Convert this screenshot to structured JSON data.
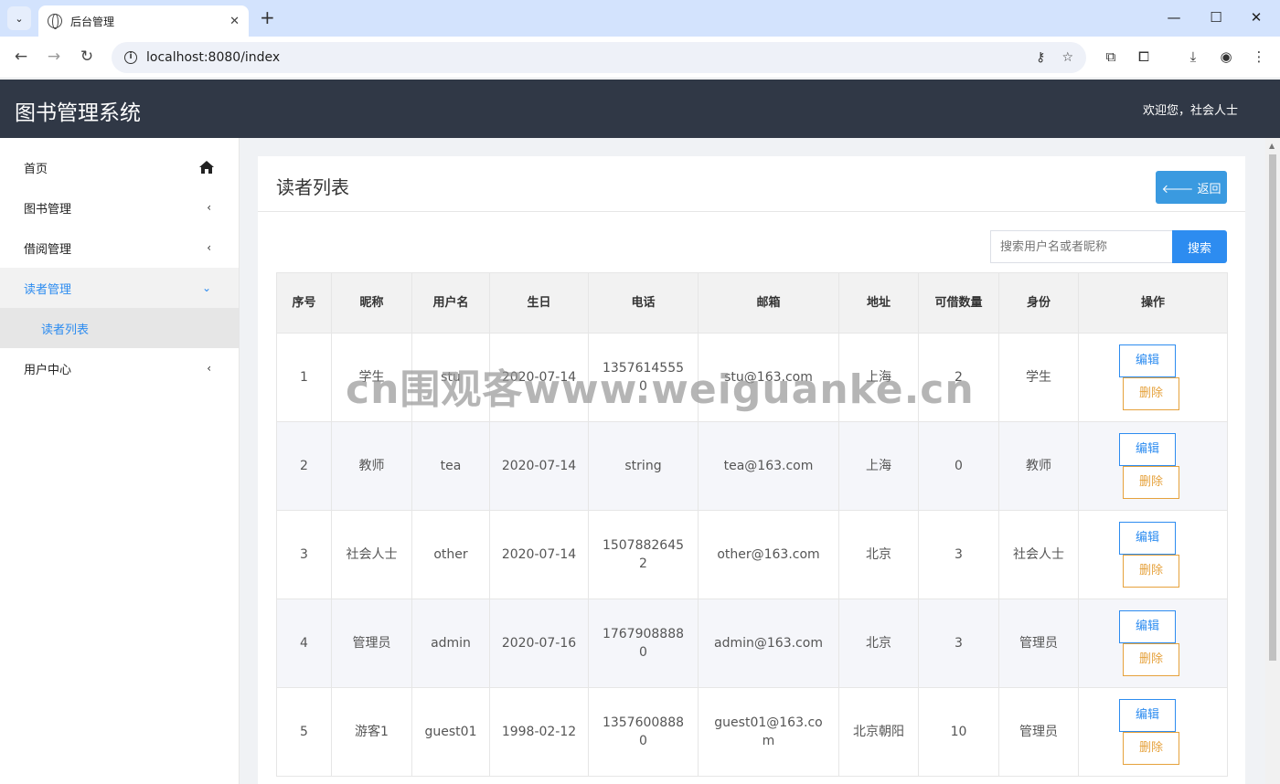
{
  "browser": {
    "tab_title": "后台管理",
    "url": "localhost:8080/index",
    "new_tab": "+",
    "tab_close": "✕"
  },
  "app": {
    "brand": "图书管理系统",
    "welcome": "欢迎您，社会人士"
  },
  "sidebar": {
    "items": [
      {
        "label": "首页"
      },
      {
        "label": "图书管理"
      },
      {
        "label": "借阅管理"
      },
      {
        "label": "读者管理"
      },
      {
        "label": "读者列表"
      },
      {
        "label": "用户中心"
      }
    ]
  },
  "page": {
    "title": "读者列表",
    "back_label": "🡐 返回",
    "search_placeholder": "搜索用户名或者昵称",
    "search_label": "搜索"
  },
  "table": {
    "headers": [
      "序号",
      "昵称",
      "用户名",
      "生日",
      "电话",
      "邮箱",
      "地址",
      "可借数量",
      "身份",
      "操作"
    ],
    "edit_label": "编辑",
    "delete_label": "删除",
    "rows": [
      [
        "1",
        "学生",
        "stu",
        "2020-07-14",
        "13576145550",
        "stu@163.com",
        "上海",
        "2",
        "学生"
      ],
      [
        "2",
        "教师",
        "tea",
        "2020-07-14",
        "string",
        "tea@163.com",
        "上海",
        "0",
        "教师"
      ],
      [
        "3",
        "社会人士",
        "other",
        "2020-07-14",
        "15078826452",
        "other@163.com",
        "北京",
        "3",
        "社会人士"
      ],
      [
        "4",
        "管理员",
        "admin",
        "2020-07-16",
        "17679088880",
        "admin@163.com",
        "北京",
        "3",
        "管理员"
      ],
      [
        "5",
        "游客1",
        "guest01",
        "1998-02-12",
        "13576008880",
        "guest01@163.com",
        "北京朝阳",
        "10",
        "管理员"
      ]
    ]
  },
  "watermark": "cn围观客www.weiguanke.cn"
}
